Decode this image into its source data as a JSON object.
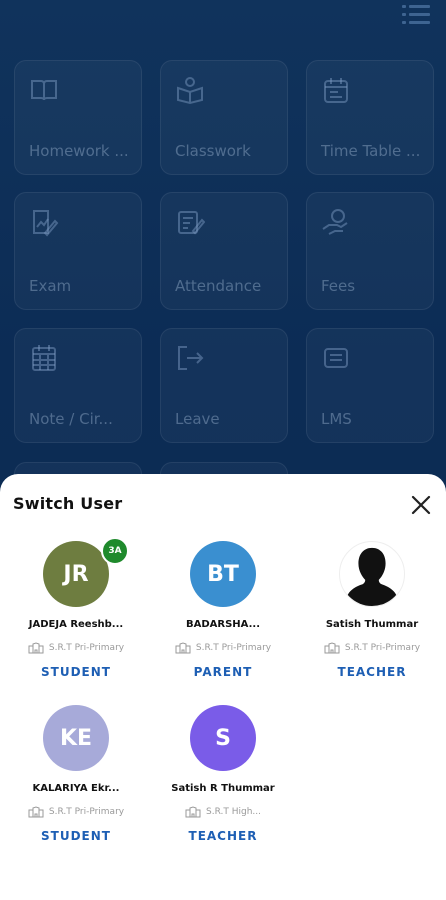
{
  "background_menu": {
    "tiles": [
      {
        "label": "Homework ...",
        "icon": "book-icon"
      },
      {
        "label": "Classwork",
        "icon": "reader-icon"
      },
      {
        "label": "Time Table ...",
        "icon": "calendar-icon"
      },
      {
        "label": "Exam",
        "icon": "exam-icon"
      },
      {
        "label": "Attendance",
        "icon": "attendance-icon"
      },
      {
        "label": "Fees",
        "icon": "fees-icon"
      },
      {
        "label": "Note / Cir...",
        "icon": "grid-calendar-icon"
      },
      {
        "label": "Leave",
        "icon": "leave-icon"
      },
      {
        "label": "LMS",
        "icon": "lms-icon"
      }
    ]
  },
  "sheet": {
    "title": "Switch User",
    "users": [
      {
        "initials": "JR",
        "badge": "3A",
        "name": "JADEJA Reeshb...",
        "school": "S.R.T Pri-Primary",
        "role": "STUDENT",
        "avatar_color": "#6e7d40"
      },
      {
        "initials": "BT",
        "badge": "",
        "name": "BADARSHA...",
        "school": "S.R.T Pri-Primary",
        "role": "PARENT",
        "avatar_color": "#3a8fd0"
      },
      {
        "initials": "",
        "badge": "",
        "name": "Satish Thummar",
        "school": "S.R.T Pri-Primary",
        "role": "TEACHER",
        "avatar_color": "#ffffff"
      },
      {
        "initials": "KE",
        "badge": "",
        "name": "KALARIYA Ekr...",
        "school": "S.R.T Pri-Primary",
        "role": "STUDENT",
        "avatar_color": "#a7aad9"
      },
      {
        "initials": "S",
        "badge": "",
        "name": "Satish R Thummar",
        "school": "S.R.T High...",
        "role": "TEACHER",
        "avatar_color": "#7a5ce8"
      }
    ]
  }
}
